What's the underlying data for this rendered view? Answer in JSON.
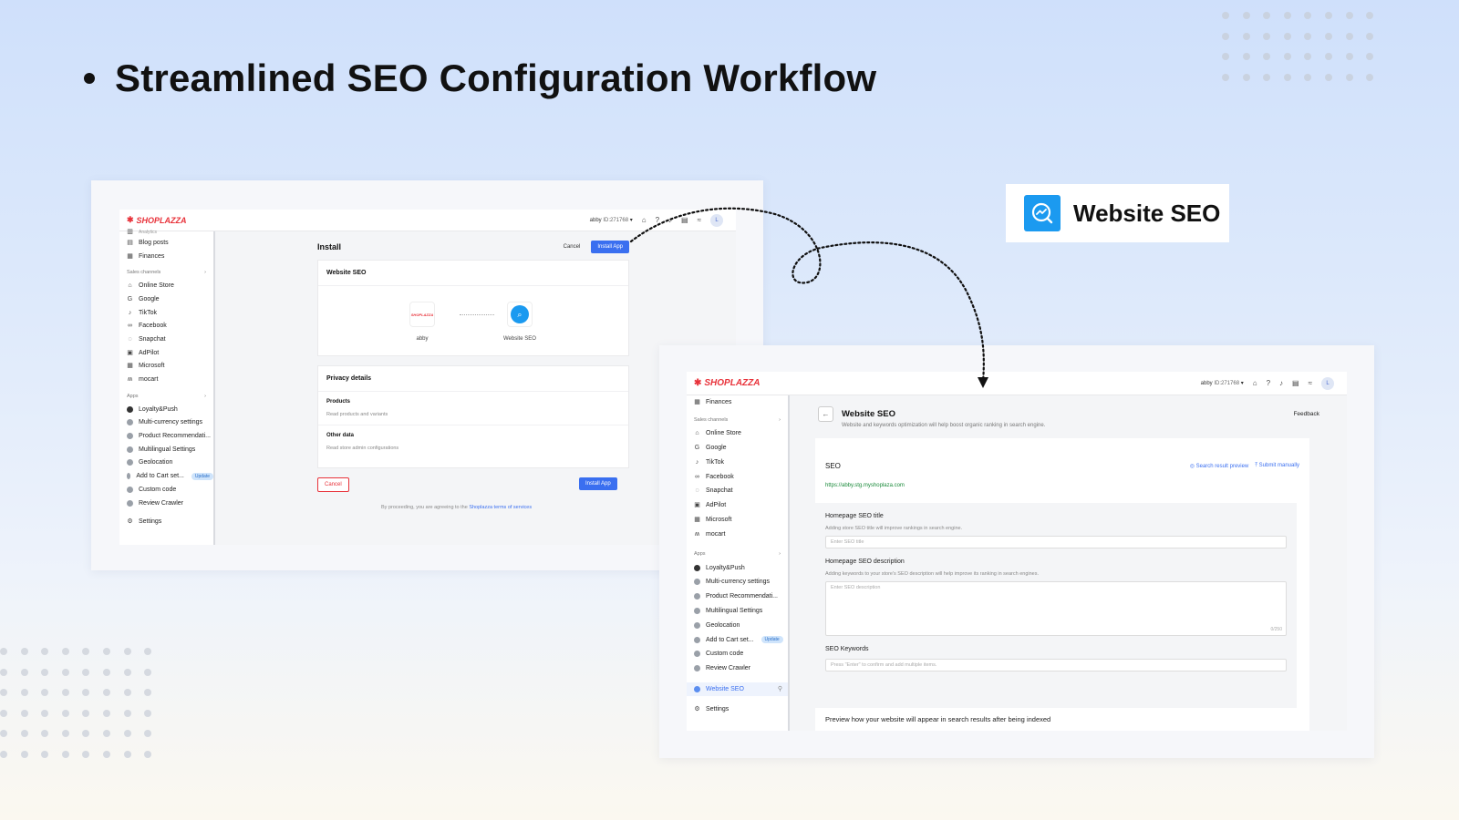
{
  "headline": "Streamlined SEO Configuration Workflow",
  "badge": {
    "label": "Website SEO",
    "icon": "analytics-search-icon",
    "color": "#1b9af0"
  },
  "brand": {
    "name": "SHOPLAZZA",
    "color": "#e8323a"
  },
  "store": {
    "name": "abby",
    "id": "ID:271768"
  },
  "avatar": "L",
  "colors": {
    "accent": "#3a6ff0",
    "danger": "#e8323a",
    "url_green": "#1a8a3a"
  },
  "install_screen": {
    "title": "Install",
    "cancel": "Cancel",
    "install_button": "Install App",
    "sidebar_top": [
      {
        "label": "Analytics",
        "icon": "analytics-icon"
      },
      {
        "label": "Blog posts",
        "icon": "blog-icon"
      },
      {
        "label": "Finances",
        "icon": "finances-icon"
      }
    ],
    "app_card_title": "Website SEO",
    "connect": {
      "left_label": "abby",
      "right_label": "Website SEO"
    },
    "privacy": {
      "title": "Privacy details",
      "rows": [
        {
          "title": "Products",
          "desc": "Read products and variants"
        },
        {
          "title": "Other data",
          "desc": "Read store admin configurations"
        }
      ]
    },
    "footer_cancel": "Cancel",
    "footer_install": "Install App",
    "agree_prefix": "By proceeding, you are agreeing to the",
    "agree_link": "Shoplazza terms of services"
  },
  "sidebar": {
    "sales_channels_label": "Sales channels",
    "sales_channels": [
      {
        "label": "Online Store",
        "icon": "store-icon"
      },
      {
        "label": "Google",
        "icon": "google-icon"
      },
      {
        "label": "TikTok",
        "icon": "tiktok-icon"
      },
      {
        "label": "Facebook",
        "icon": "facebook-icon"
      },
      {
        "label": "Snapchat",
        "icon": "snapchat-icon"
      },
      {
        "label": "AdPilot",
        "icon": "adpilot-icon"
      },
      {
        "label": "Microsoft",
        "icon": "microsoft-icon"
      },
      {
        "label": "mocart",
        "icon": "mocart-icon"
      }
    ],
    "apps_label": "Apps",
    "apps": [
      {
        "label": "Loyalty&Push",
        "icon": "loyalty-icon"
      },
      {
        "label": "Multi-currency settings",
        "icon": "currency-icon"
      },
      {
        "label": "Product Recommendati...",
        "icon": "recommendation-icon"
      },
      {
        "label": "Multilingual Settings",
        "icon": "language-icon"
      },
      {
        "label": "Geolocation",
        "icon": "geolocation-icon"
      },
      {
        "label": "Add to Cart set...",
        "icon": "cart-icon",
        "badge": "Update"
      },
      {
        "label": "Custom code",
        "icon": "code-icon"
      },
      {
        "label": "Review Crawler",
        "icon": "review-icon"
      }
    ],
    "active_app": "Website SEO",
    "settings": "Settings",
    "finances": "Finances"
  },
  "seo_screen": {
    "title": "Website SEO",
    "subtitle": "Website and keywords optimization will help boost organic ranking in search engine.",
    "feedback": "Feedback",
    "section": "SEO",
    "preview_link": "Search result preview",
    "submit_link": "Submit manually",
    "url": "https://abby.stg.myshoplaza.com",
    "fields": {
      "title_label": "Homepage SEO title",
      "title_desc": "Adding store SEO title will improve rankings in search engine.",
      "title_placeholder": "Enter SEO title",
      "desc_label": "Homepage SEO description",
      "desc_desc": "Adding keywords to your store's SEO description will help improve its ranking in search engines.",
      "desc_placeholder": "Enter SEO description",
      "desc_counter": "0/250",
      "keywords_label": "SEO Keywords",
      "keywords_placeholder": "Press \"Enter\" to confirm and add multiple items."
    },
    "preview_text": "Preview how your website will appear in search results after being indexed"
  }
}
